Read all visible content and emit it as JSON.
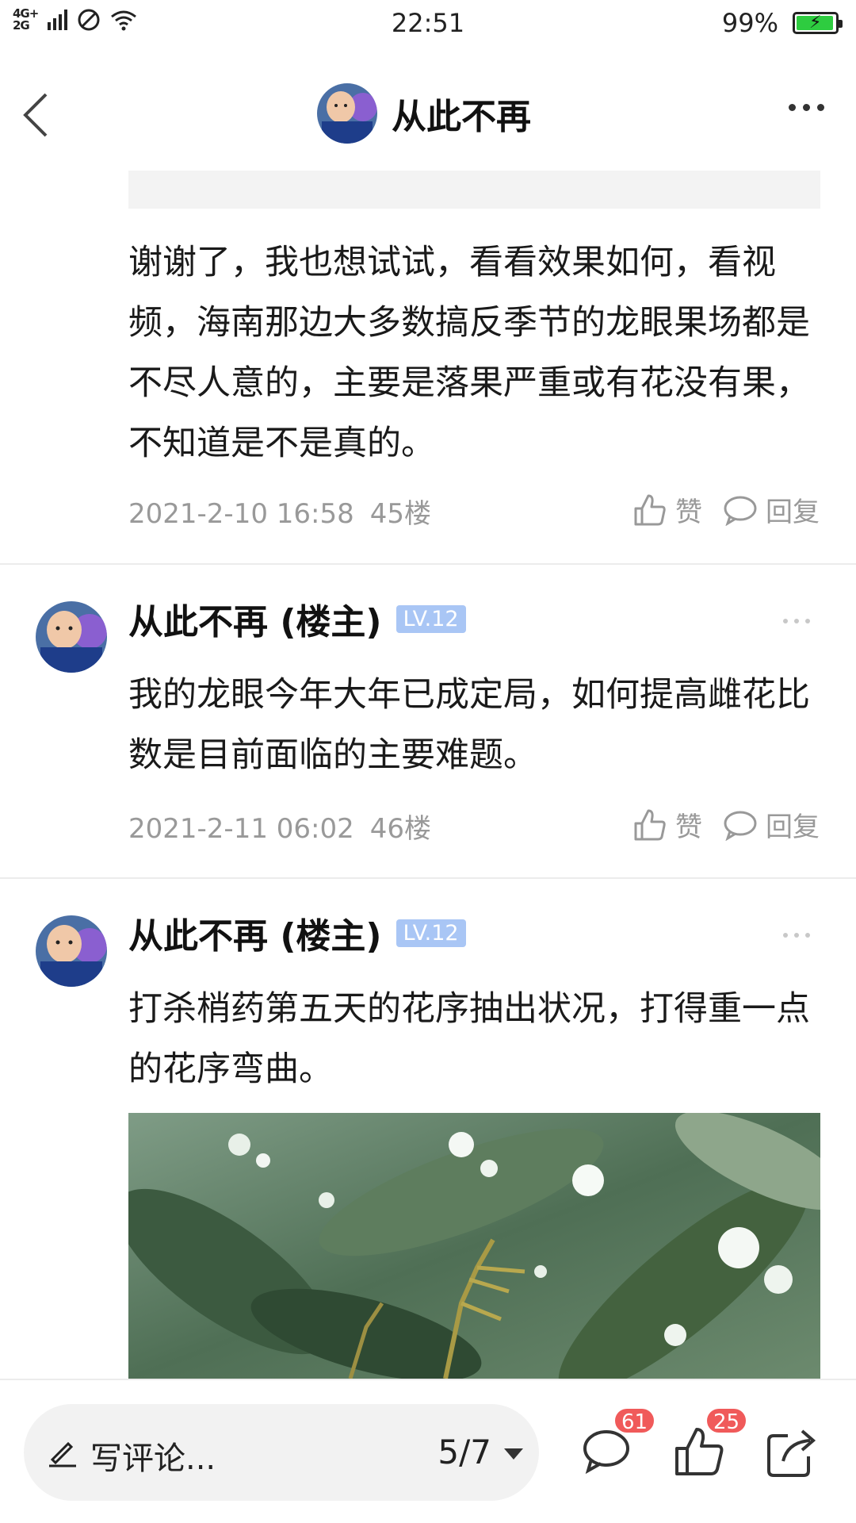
{
  "status_bar": {
    "network_label": "4G+\n2G",
    "time": "22:51",
    "battery_percent": "99%",
    "battery_level": 0.99
  },
  "header": {
    "title": "从此不再"
  },
  "posts": [
    {
      "text": "谢谢了，我也想试试，看看效果如何，看视频，海南那边大多数搞反季节的龙眼果场都是不尽人意的，主要是落果严重或有花没有果，不知道是不是真的。",
      "date": "2021-2-10 16:58",
      "floor": "45楼",
      "like_label": "赞",
      "reply_label": "回复"
    },
    {
      "author": "从此不再 (楼主)",
      "level": "LV.12",
      "text": "我的龙眼今年大年已成定局，如何提高雌花比数是目前面临的主要难题。",
      "date": "2021-2-11 06:02",
      "floor": "46楼",
      "like_label": "赞",
      "reply_label": "回复"
    },
    {
      "author": "从此不再 (楼主)",
      "level": "LV.12",
      "text": "打杀梢药第五天的花序抽出状况，打得重一点的花序弯曲。"
    }
  ],
  "bottom_bar": {
    "comment_placeholder": "写评论...",
    "page_indicator": "5/7",
    "comment_count": "61",
    "like_count": "25"
  },
  "colors": {
    "badge_red": "#f05a5a",
    "level_badge": "#a9c6f5",
    "battery_green": "#2ecc40",
    "meta_gray": "#999999"
  }
}
